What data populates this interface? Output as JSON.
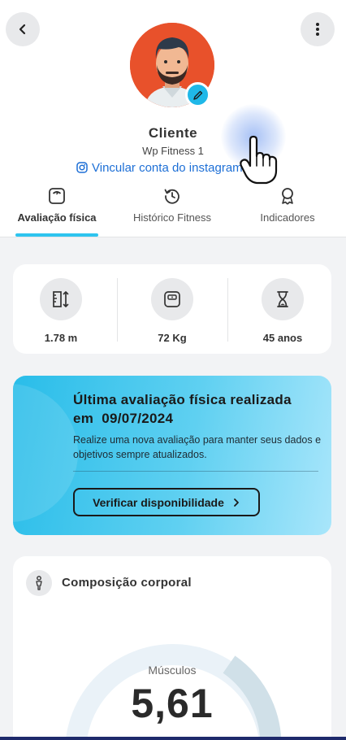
{
  "header": {
    "back_icon": "chevron-left-icon",
    "more_icon": "more-vertical-icon",
    "avatar_icon": "user-avatar",
    "edit_icon": "pencil-icon",
    "name": "Cliente",
    "company": "Wp Fitness 1",
    "instagram_link": "Vincular conta do instagram",
    "instagram_icon": "instagram-icon"
  },
  "tabs": [
    {
      "label": "Avaliação física",
      "icon": "scale-icon",
      "active": true
    },
    {
      "label": "Histórico Fitness",
      "icon": "history-icon",
      "active": false
    },
    {
      "label": "Indicadores",
      "icon": "award-icon",
      "active": false
    }
  ],
  "stats": [
    {
      "value": "1.78 m",
      "icon": "height-icon"
    },
    {
      "value": "72 Kg",
      "icon": "weight-scale-icon"
    },
    {
      "value": "45 anos",
      "icon": "hourglass-icon"
    }
  ],
  "promo": {
    "title_line1": "Última avaliação física realizada",
    "title_line2": "em  09/07/2024",
    "text": "Realize uma nova avaliação para manter seus dados e objetivos sempre atualizados.",
    "button_label": "Verificar disponibilidade",
    "button_icon": "chevron-right-icon"
  },
  "body_composition": {
    "title": "Composição corporal",
    "icon": "person-icon",
    "gauge_label": "Músculos",
    "gauge_value": "5,61"
  },
  "colors": {
    "accent": "#2ec4ef",
    "link": "#1d6fd6",
    "avatar_bg": "#e8512b",
    "gauge_track": "#d0e0e8",
    "gauge_fill": "#1ec1f0"
  }
}
